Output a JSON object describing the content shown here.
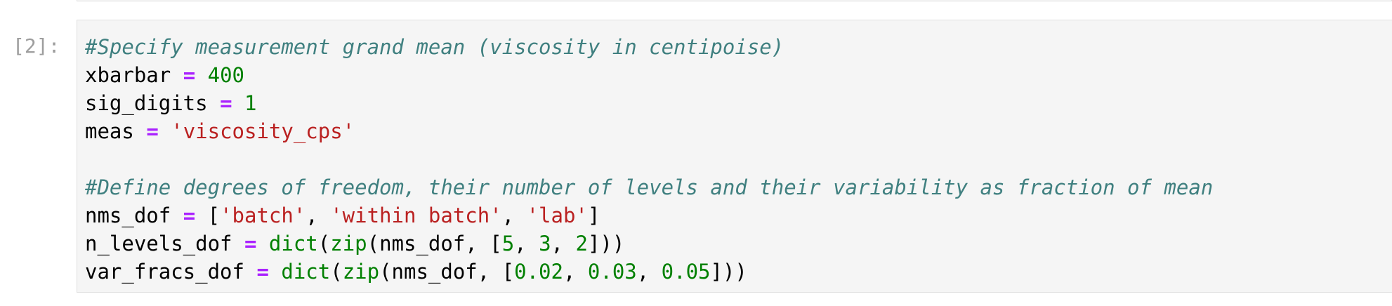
{
  "cell": {
    "prompt": "[2]:",
    "lines": [
      [
        {
          "t": "c",
          "v": "#Specify measurement grand mean (viscosity in centipoise)"
        }
      ],
      [
        {
          "t": "x",
          "v": "xbarbar "
        },
        {
          "t": "o",
          "v": "="
        },
        {
          "t": "x",
          "v": " "
        },
        {
          "t": "n",
          "v": "400"
        }
      ],
      [
        {
          "t": "x",
          "v": "sig_digits "
        },
        {
          "t": "o",
          "v": "="
        },
        {
          "t": "x",
          "v": " "
        },
        {
          "t": "n",
          "v": "1"
        }
      ],
      [
        {
          "t": "x",
          "v": "meas "
        },
        {
          "t": "o",
          "v": "="
        },
        {
          "t": "x",
          "v": " "
        },
        {
          "t": "s",
          "v": "'viscosity_cps'"
        }
      ],
      [],
      [
        {
          "t": "c",
          "v": "#Define degrees of freedom, their number of levels and their variability as fraction of mean"
        }
      ],
      [
        {
          "t": "x",
          "v": "nms_dof "
        },
        {
          "t": "o",
          "v": "="
        },
        {
          "t": "x",
          "v": " ["
        },
        {
          "t": "s",
          "v": "'batch'"
        },
        {
          "t": "x",
          "v": ", "
        },
        {
          "t": "s",
          "v": "'within batch'"
        },
        {
          "t": "x",
          "v": ", "
        },
        {
          "t": "s",
          "v": "'lab'"
        },
        {
          "t": "x",
          "v": "]"
        }
      ],
      [
        {
          "t": "x",
          "v": "n_levels_dof "
        },
        {
          "t": "o",
          "v": "="
        },
        {
          "t": "x",
          "v": " "
        },
        {
          "t": "b",
          "v": "dict"
        },
        {
          "t": "x",
          "v": "("
        },
        {
          "t": "b",
          "v": "zip"
        },
        {
          "t": "x",
          "v": "(nms_dof, ["
        },
        {
          "t": "n",
          "v": "5"
        },
        {
          "t": "x",
          "v": ", "
        },
        {
          "t": "n",
          "v": "3"
        },
        {
          "t": "x",
          "v": ", "
        },
        {
          "t": "n",
          "v": "2"
        },
        {
          "t": "x",
          "v": "]))"
        }
      ],
      [
        {
          "t": "x",
          "v": "var_fracs_dof "
        },
        {
          "t": "o",
          "v": "="
        },
        {
          "t": "x",
          "v": " "
        },
        {
          "t": "b",
          "v": "dict"
        },
        {
          "t": "x",
          "v": "("
        },
        {
          "t": "b",
          "v": "zip"
        },
        {
          "t": "x",
          "v": "(nms_dof, ["
        },
        {
          "t": "n",
          "v": "0.02"
        },
        {
          "t": "x",
          "v": ", "
        },
        {
          "t": "n",
          "v": "0.03"
        },
        {
          "t": "x",
          "v": ", "
        },
        {
          "t": "n",
          "v": "0.05"
        },
        {
          "t": "x",
          "v": "]))"
        }
      ]
    ]
  },
  "colors": {
    "comment": "#408080",
    "operator": "#aa22ff",
    "number": "#008000",
    "string": "#ba2121",
    "builtin": "#008000",
    "prompt": "#9e9e9e",
    "cell_background": "#f5f5f5",
    "cell_border": "#e0e0e0"
  }
}
